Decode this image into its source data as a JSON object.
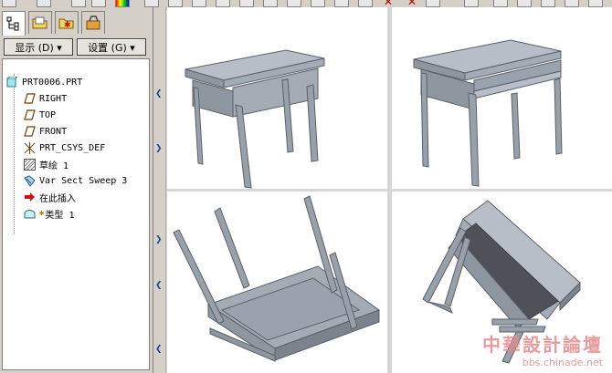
{
  "toolbar": {
    "red_x_1": "✕",
    "red_x_2": "✕"
  },
  "left_panel": {
    "tabs": [
      {
        "icon": "model-tree-icon",
        "active": true
      },
      {
        "icon": "folder-icon",
        "active": false
      },
      {
        "icon": "favorites-icon",
        "active": false
      },
      {
        "icon": "tools-icon",
        "active": false
      }
    ],
    "display_button": "显示 (D) ▾",
    "settings_button": "设置 (G) ▾",
    "tree": {
      "root": "PRT0006.PRT",
      "items": [
        {
          "label": "RIGHT",
          "icon": "datum-plane-icon"
        },
        {
          "label": "TOP",
          "icon": "datum-plane-icon"
        },
        {
          "label": "FRONT",
          "icon": "datum-plane-icon"
        },
        {
          "label": "PRT_CSYS_DEF",
          "icon": "csys-icon"
        },
        {
          "label": "草绘 1",
          "icon": "sketch-icon"
        },
        {
          "label": "Var Sect Sweep 3",
          "icon": "sweep-icon"
        },
        {
          "label": "在此插入",
          "icon": "insert-arrow-icon"
        },
        {
          "label": "类型 1",
          "icon": "feature-type-icon"
        }
      ]
    }
  },
  "watermark": {
    "title": "中華設計論壇",
    "url": "bbs.chinade.net"
  },
  "colors": {
    "model_face_light": "#b7bec7",
    "model_face_mid": "#9aa3ad",
    "model_face_dark": "#7b838d",
    "model_inner_dark": "#4e5157",
    "watermark": "#e58a8a",
    "accent_blue": "#1a3ca0"
  }
}
